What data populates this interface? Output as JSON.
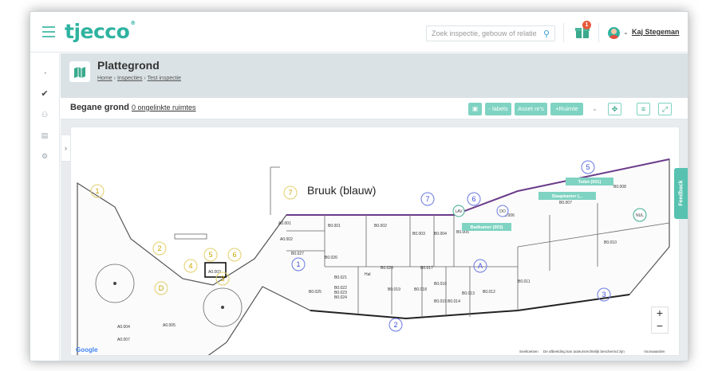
{
  "app": {
    "logo": "tjecco",
    "logo_mark": "®"
  },
  "search": {
    "placeholder": "Zoek inspectie, gebouw of relatie"
  },
  "notifications": {
    "count": "1"
  },
  "user": {
    "name": "Kaj Stegeman"
  },
  "page": {
    "title": "Plattegrond",
    "breadcrumb": [
      "Home",
      "Inspecties",
      "Test inspectie"
    ],
    "breadcrumb_sep": "›"
  },
  "toolbar": {
    "floor_name": "Begane grond",
    "unlinked_label": "0 ongelinkte ruimtes",
    "labels_button": "- labels",
    "asset_button": "Asset nr's",
    "add_room_button": "+Ruimte"
  },
  "map": {
    "annotation": "Bruuk (blauw)",
    "google_label": "Google",
    "footer": [
      "Sneltoetsen",
      "De afbeelding kan auteursrechtelijk beschermd zijn",
      "Voorwaarden"
    ],
    "tooltips": [
      "Toilet (001)",
      "Slaapkamer (...",
      "Badkamer (003)"
    ],
    "room_labels": [
      "A0.001",
      "A0.002",
      "A0.003",
      "A0.004",
      "A0.005",
      "A0.007",
      "B0.001",
      "B0.002",
      "B0.003",
      "B0.004",
      "B0.005",
      "B0.006",
      "B0.007",
      "B0.008",
      "B0.010",
      "B0.011",
      "B0.012",
      "B0.013",
      "B0.014",
      "B0.015",
      "B0.016",
      "B0.017",
      "B0.018",
      "B0.019",
      "B0.020",
      "B0.021",
      "B0.022",
      "B0.023",
      "B0.024",
      "B0.025",
      "B0.026",
      "B0.027",
      "Hal"
    ],
    "circle_labels_blue": [
      "1",
      "2",
      "3",
      "5",
      "6",
      "7",
      "A"
    ],
    "circle_labels_yellow": [
      "1",
      "2",
      "3",
      "4",
      "5",
      "6",
      "7",
      "D"
    ],
    "badge_labels": [
      "LAV",
      "DO",
      "NUL"
    ]
  },
  "feedback": {
    "label": "Feedback"
  },
  "colors": {
    "accent": "#2fb3a0",
    "button": "#7fd3c2",
    "badge": "#e65a3a"
  }
}
